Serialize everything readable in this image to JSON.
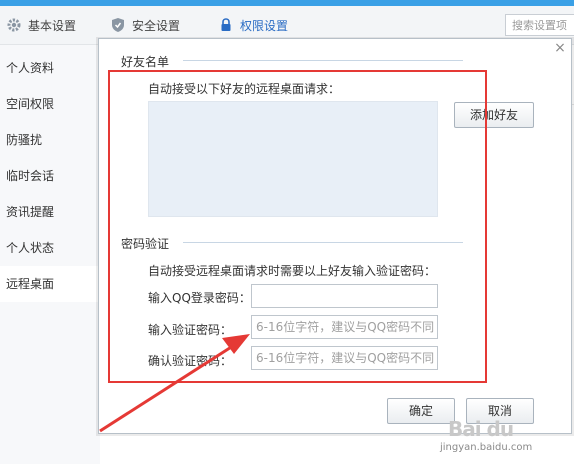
{
  "background_window": {
    "tabs": [
      {
        "label": "基本设置",
        "icon": "gear-icon"
      },
      {
        "label": "安全设置",
        "icon": "shield-icon"
      },
      {
        "label": "权限设置",
        "icon": "lock-icon"
      }
    ],
    "search_placeholder": "搜索设置项",
    "sidebar_items": [
      "个人资料",
      "空间权限",
      "防骚扰",
      "临时会话",
      "资讯提醒",
      "个人状态",
      "远程桌面"
    ],
    "active_sidebar_item": "远程桌面"
  },
  "dialog": {
    "close_glyph": "×",
    "friend_list": {
      "section_title": "好友名单",
      "description": "自动接受以下好友的远程桌面请求：",
      "add_friend_button": "添加好友"
    },
    "password": {
      "section_title": "密码验证",
      "description": "自动接受远程桌面请求时需要以上好友输入验证密码：",
      "fields": [
        {
          "label": "输入QQ登录密码：",
          "placeholder": ""
        },
        {
          "label": "输入验证密码：",
          "placeholder": "6-16位字符，建议与QQ密码不同"
        },
        {
          "label": "确认验证密码：",
          "placeholder": "6-16位字符，建议与QQ密码不同"
        }
      ]
    },
    "ok_button": "确定",
    "cancel_button": "取消"
  },
  "annotation": {
    "color": "#e53935"
  },
  "watermark": {
    "brand": "Bai du",
    "url": "jingyan.baidu.com"
  },
  "colors": {
    "accent": "#3aa0e6",
    "active_tab": "#2a6cc4"
  }
}
